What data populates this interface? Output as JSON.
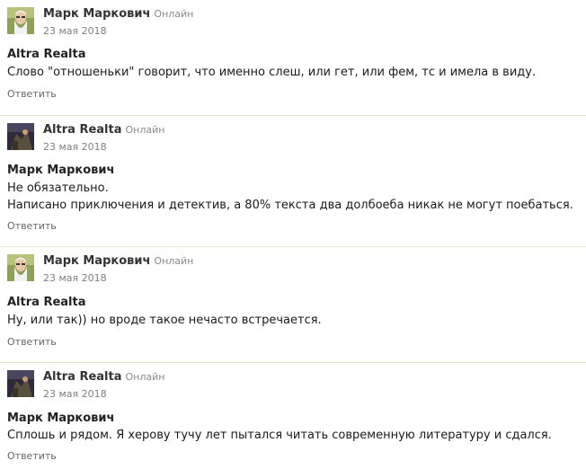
{
  "comments": [
    {
      "author": "Марк Маркович",
      "status": "Онлайн",
      "date": "23 мая 2018",
      "reply_to": "Altra Realta",
      "lines": [
        "Слово \"отношеньки\" говорит, что именно слеш, или гет, или фем, тс и имела в виду."
      ],
      "reply_label": "Ответить",
      "avatar": "mark-avatar"
    },
    {
      "author": "Altra Realta",
      "status": "Онлайн",
      "date": "23 мая 2018",
      "reply_to": "Марк Маркович",
      "lines": [
        "Не обязательно.",
        "Написано приключения и детектив, а 80% текста два долбоеба никак не могут поебаться."
      ],
      "reply_label": "Ответить",
      "avatar": "altra-avatar"
    },
    {
      "author": "Марк Маркович",
      "status": "Онлайн",
      "date": "23 мая 2018",
      "reply_to": "Altra Realta",
      "lines": [
        "Ну, или так)) но вроде такое нечасто встречается."
      ],
      "reply_label": "Ответить",
      "avatar": "mark-avatar"
    },
    {
      "author": "Altra Realta",
      "status": "Онлайн",
      "date": "23 мая 2018",
      "reply_to": "Марк Маркович",
      "lines": [
        "Сплошь и рядом. Я херову тучу лет пытался читать современную литературу и сдался."
      ],
      "reply_label": "Ответить",
      "avatar": "altra-avatar"
    }
  ]
}
